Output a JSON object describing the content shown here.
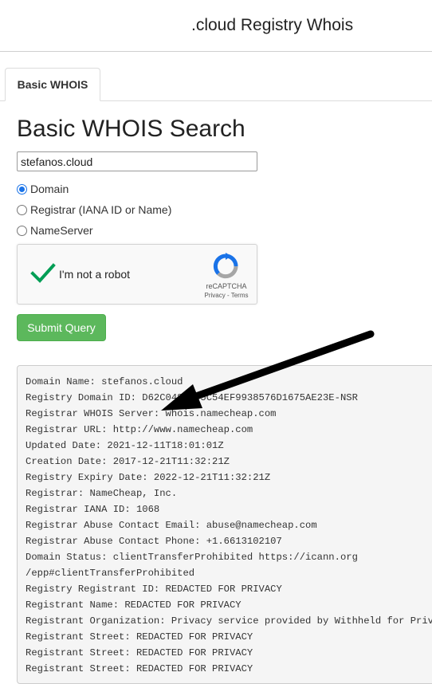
{
  "header": {
    "title": ".cloud Registry Whois"
  },
  "tabs": [
    {
      "label": "Basic WHOIS"
    }
  ],
  "page": {
    "title": "Basic WHOIS Search"
  },
  "search": {
    "value": "stefanos.cloud"
  },
  "options": [
    {
      "label": "Domain",
      "checked": true
    },
    {
      "label": "Registrar (IANA ID or Name)",
      "checked": false
    },
    {
      "label": "NameServer",
      "checked": false
    }
  ],
  "captcha": {
    "label": "I'm not a robot",
    "brand": "reCAPTCHA",
    "links": "Privacy - Terms",
    "colors": {
      "check": "#009e55",
      "logo_blue": "#1a73e8",
      "logo_grey": "#a6a6a6"
    }
  },
  "submit": {
    "label": "Submit Query",
    "color": "#5cb85c"
  },
  "result": {
    "lines": [
      "Domain Name: stefanos.cloud",
      "Registry Domain ID: D62C0483175C54EF9938576D1675AE23E-NSR",
      "Registrar WHOIS Server: whois.namecheap.com",
      "Registrar URL: http://www.namecheap.com",
      "Updated Date: 2021-12-11T18:01:01Z",
      "Creation Date: 2017-12-21T11:32:21Z",
      "Registry Expiry Date: 2022-12-21T11:32:21Z",
      "Registrar: NameCheap, Inc.",
      "Registrar IANA ID: 1068",
      "Registrar Abuse Contact Email: abuse@namecheap.com",
      "Registrar Abuse Contact Phone: +1.6613102107",
      "Domain Status: clientTransferProhibited https://icann.org",
      "/epp#clientTransferProhibited",
      "Registry Registrant ID: REDACTED FOR PRIVACY",
      "Registrant Name: REDACTED FOR PRIVACY",
      "Registrant Organization: Privacy service provided by Withheld for Privacy ehf",
      "Registrant Street: REDACTED FOR PRIVACY",
      "Registrant Street: REDACTED FOR PRIVACY",
      "Registrant Street: REDACTED FOR PRIVACY"
    ]
  }
}
